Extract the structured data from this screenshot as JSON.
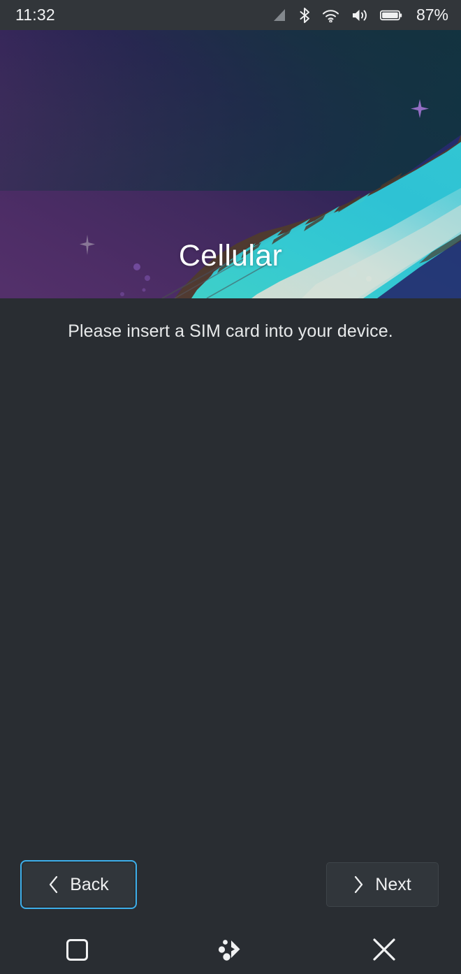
{
  "status_bar": {
    "clock": "11:32",
    "battery_percent": "87%",
    "icons": [
      {
        "name": "cellular-signal-icon",
        "label": "cellular signal"
      },
      {
        "name": "bluetooth-icon",
        "label": "bluetooth"
      },
      {
        "name": "wifi-icon",
        "label": "wifi"
      },
      {
        "name": "volume-icon",
        "label": "volume"
      },
      {
        "name": "battery-icon",
        "label": "battery"
      }
    ],
    "background_color": "#32363a",
    "text_color": "#f2f3f4"
  },
  "header": {
    "title": "Cellular",
    "artwork_name": "plasma-mobile-banner-artwork",
    "colors": {
      "sky_top": "#14303a",
      "sky_purple": "#4a2c63",
      "deep_blue": "#2a2a64",
      "brush_cyan": "#2fc9cf",
      "brush_light": "#bfe4dd",
      "brush_cream": "#e2e3dc",
      "brush_outline": "#4a3a2c",
      "sparkle_purple": "#a06fd0",
      "sparkle_gray": "#b6b0bd"
    }
  },
  "main": {
    "message": "Please insert a SIM card into your device.",
    "background_color": "#292d32",
    "text_color": "#e7e9ea"
  },
  "buttons": {
    "back": {
      "label": "Back",
      "icon": "chevron-left-icon",
      "focused": true
    },
    "next": {
      "label": "Next",
      "icon": "chevron-right-icon",
      "focused": false
    },
    "focus_color": "#3daee9",
    "fill_color": "#31363b"
  },
  "navigation_bar": {
    "items": [
      {
        "name": "task-switcher-button",
        "icon": "rounded-square-icon",
        "label": "Task switcher"
      },
      {
        "name": "home-button",
        "icon": "kde-plasma-logo-icon",
        "label": "Home"
      },
      {
        "name": "close-button",
        "icon": "close-x-icon",
        "label": "Close"
      }
    ]
  }
}
